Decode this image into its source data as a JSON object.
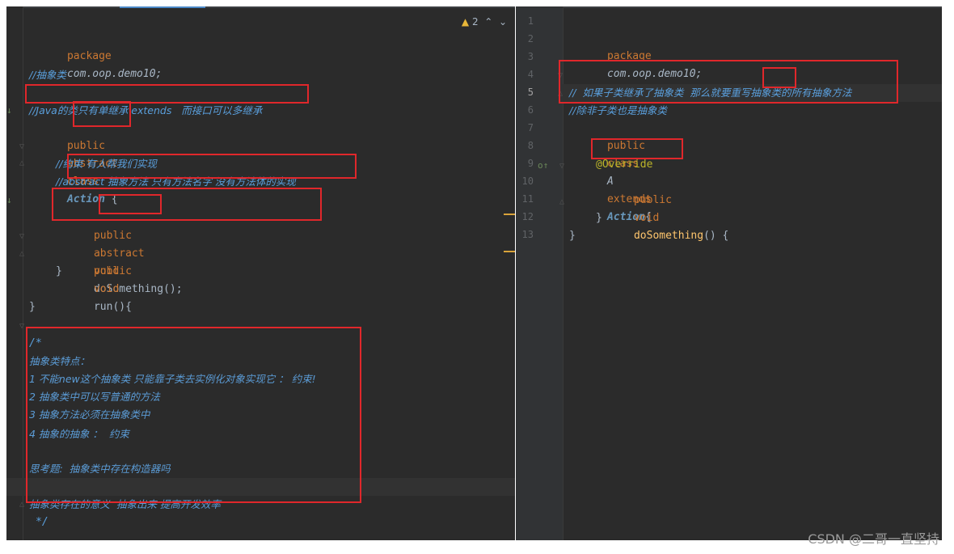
{
  "left_editor": {
    "warning_count": "2",
    "lines": [
      "package com.oop.demo10;",
      "//抽象类",
      "//Java的类只有单继承 extends   而接口可以多继承",
      "public abstract class Action {",
      "//约束 有人帮我们实现",
      "//abstract 抽象方法 只有方法名字 没有方法体的实现",
      "public abstract void doSomething();",
      "public void run(){",
      "}",
      "}",
      "/*",
      "抽象类特点：",
      "1 不能new这个抽象类 只能靠子类去实例化对象实现它 ： 约束!",
      "2 抽象类中可以写普通的方法",
      "3 抽象方法必须在抽象类中",
      "4 抽象的抽象 ：  约束",
      "思考题:  抽象类中存在构造器吗",
      "抽象类存在的意义  抽象出来 提高开发效率",
      "*/"
    ],
    "tokens": {
      "public": "public",
      "abstract": "abstract",
      "class": "class",
      "Action": "Action",
      "brace_open": " {",
      "void": "void",
      "doSomething": "doSomething",
      "parens_semicolon": "();",
      "run": "run",
      "run_parens": "(){",
      "package": "package",
      "package_name": "com.oop.demo10;"
    }
  },
  "right_editor": {
    "line_numbers": [
      "1",
      "2",
      "3",
      "4",
      "5",
      "6",
      "7",
      "8",
      "9",
      "10",
      "11",
      "12",
      "13"
    ],
    "current_line": "5",
    "lines": [
      "package com.oop.demo10;",
      "//  如果子类继承了抽象类  那么就要重写抽象类的所有抽象方法",
      "//除非子类也是抽象类",
      "public class A extends Action{",
      "@Override",
      "public void doSomething() {",
      "}",
      "}"
    ],
    "tokens": {
      "public": "public",
      "class": "class",
      "A": "A",
      "extends": "extends",
      "Action": "Action",
      "brace_open": "{",
      "void": "void",
      "doSomething": "doSomething",
      "parens_brace": "() {",
      "package": "package",
      "package_name": "com.oop.demo10;"
    }
  },
  "watermark": "CSDN @二哥一直坚持",
  "colors": {
    "editor_bg": "#2b2b2b",
    "keyword": "#cc7832",
    "comment_blue": "#5a9fdc",
    "highlight_box": "#e0272b",
    "annotation": "#bbb529",
    "method_decl": "#ffc66d"
  }
}
